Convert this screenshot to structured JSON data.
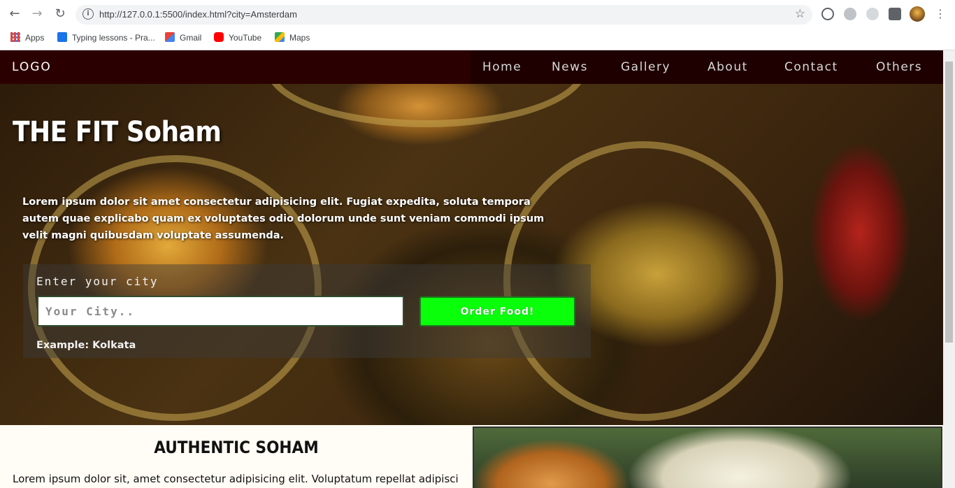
{
  "browser": {
    "url": "http://127.0.0.1:5500/index.html?city=Amsterdam",
    "bookmarks": [
      {
        "label": "Apps",
        "icon": "apps-grid-icon"
      },
      {
        "label": "Typing lessons - Pra...",
        "icon": "keyboard-icon"
      },
      {
        "label": "Gmail",
        "icon": "gmail-icon"
      },
      {
        "label": "YouTube",
        "icon": "youtube-icon"
      },
      {
        "label": "Maps",
        "icon": "maps-icon"
      }
    ]
  },
  "site": {
    "logo": "LOGO",
    "nav": [
      "Home",
      "News",
      "Gallery",
      "About",
      "Contact",
      "Others"
    ],
    "hero": {
      "title": "THE FIT Soham",
      "description": "Lorem ipsum dolor sit amet consectetur adipisicing elit. Fugiat expedita, soluta tempora autem quae explicabo quam ex voluptates odio dolorum unde sunt veniam commodi ipsum velit magni quibusdam voluptate assumenda."
    },
    "order_form": {
      "label": "Enter your city",
      "placeholder": "Your City..",
      "button": "Order Food!",
      "example": "Example: Kolkata"
    },
    "section": {
      "title": "AUTHENTIC SOHAM",
      "text": "Lorem ipsum dolor sit, amet consectetur adipisicing elit. Voluptatum repellat adipisci"
    }
  },
  "colors": {
    "logo_bg": "#2b0000",
    "menu_bg": "#1f0000",
    "order_button": "#0aff0a",
    "section_bg": "#fffdf5"
  }
}
